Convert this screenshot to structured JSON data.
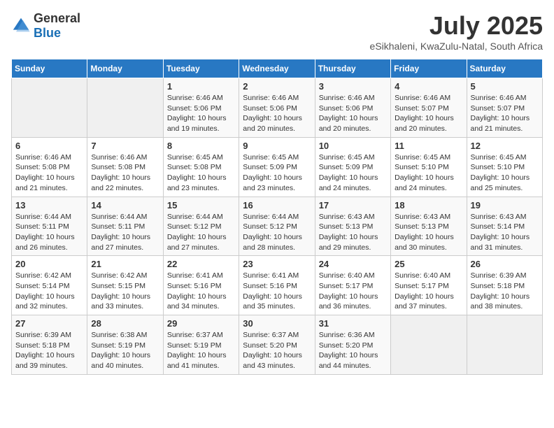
{
  "logo": {
    "general": "General",
    "blue": "Blue"
  },
  "title": "July 2025",
  "subtitle": "eSikhaleni, KwaZulu-Natal, South Africa",
  "weekdays": [
    "Sunday",
    "Monday",
    "Tuesday",
    "Wednesday",
    "Thursday",
    "Friday",
    "Saturday"
  ],
  "weeks": [
    [
      {
        "day": "",
        "sunrise": "",
        "sunset": "",
        "daylight": ""
      },
      {
        "day": "",
        "sunrise": "",
        "sunset": "",
        "daylight": ""
      },
      {
        "day": "1",
        "sunrise": "Sunrise: 6:46 AM",
        "sunset": "Sunset: 5:06 PM",
        "daylight": "Daylight: 10 hours and 19 minutes."
      },
      {
        "day": "2",
        "sunrise": "Sunrise: 6:46 AM",
        "sunset": "Sunset: 5:06 PM",
        "daylight": "Daylight: 10 hours and 20 minutes."
      },
      {
        "day": "3",
        "sunrise": "Sunrise: 6:46 AM",
        "sunset": "Sunset: 5:06 PM",
        "daylight": "Daylight: 10 hours and 20 minutes."
      },
      {
        "day": "4",
        "sunrise": "Sunrise: 6:46 AM",
        "sunset": "Sunset: 5:07 PM",
        "daylight": "Daylight: 10 hours and 20 minutes."
      },
      {
        "day": "5",
        "sunrise": "Sunrise: 6:46 AM",
        "sunset": "Sunset: 5:07 PM",
        "daylight": "Daylight: 10 hours and 21 minutes."
      }
    ],
    [
      {
        "day": "6",
        "sunrise": "Sunrise: 6:46 AM",
        "sunset": "Sunset: 5:08 PM",
        "daylight": "Daylight: 10 hours and 21 minutes."
      },
      {
        "day": "7",
        "sunrise": "Sunrise: 6:46 AM",
        "sunset": "Sunset: 5:08 PM",
        "daylight": "Daylight: 10 hours and 22 minutes."
      },
      {
        "day": "8",
        "sunrise": "Sunrise: 6:45 AM",
        "sunset": "Sunset: 5:08 PM",
        "daylight": "Daylight: 10 hours and 23 minutes."
      },
      {
        "day": "9",
        "sunrise": "Sunrise: 6:45 AM",
        "sunset": "Sunset: 5:09 PM",
        "daylight": "Daylight: 10 hours and 23 minutes."
      },
      {
        "day": "10",
        "sunrise": "Sunrise: 6:45 AM",
        "sunset": "Sunset: 5:09 PM",
        "daylight": "Daylight: 10 hours and 24 minutes."
      },
      {
        "day": "11",
        "sunrise": "Sunrise: 6:45 AM",
        "sunset": "Sunset: 5:10 PM",
        "daylight": "Daylight: 10 hours and 24 minutes."
      },
      {
        "day": "12",
        "sunrise": "Sunrise: 6:45 AM",
        "sunset": "Sunset: 5:10 PM",
        "daylight": "Daylight: 10 hours and 25 minutes."
      }
    ],
    [
      {
        "day": "13",
        "sunrise": "Sunrise: 6:44 AM",
        "sunset": "Sunset: 5:11 PM",
        "daylight": "Daylight: 10 hours and 26 minutes."
      },
      {
        "day": "14",
        "sunrise": "Sunrise: 6:44 AM",
        "sunset": "Sunset: 5:11 PM",
        "daylight": "Daylight: 10 hours and 27 minutes."
      },
      {
        "day": "15",
        "sunrise": "Sunrise: 6:44 AM",
        "sunset": "Sunset: 5:12 PM",
        "daylight": "Daylight: 10 hours and 27 minutes."
      },
      {
        "day": "16",
        "sunrise": "Sunrise: 6:44 AM",
        "sunset": "Sunset: 5:12 PM",
        "daylight": "Daylight: 10 hours and 28 minutes."
      },
      {
        "day": "17",
        "sunrise": "Sunrise: 6:43 AM",
        "sunset": "Sunset: 5:13 PM",
        "daylight": "Daylight: 10 hours and 29 minutes."
      },
      {
        "day": "18",
        "sunrise": "Sunrise: 6:43 AM",
        "sunset": "Sunset: 5:13 PM",
        "daylight": "Daylight: 10 hours and 30 minutes."
      },
      {
        "day": "19",
        "sunrise": "Sunrise: 6:43 AM",
        "sunset": "Sunset: 5:14 PM",
        "daylight": "Daylight: 10 hours and 31 minutes."
      }
    ],
    [
      {
        "day": "20",
        "sunrise": "Sunrise: 6:42 AM",
        "sunset": "Sunset: 5:14 PM",
        "daylight": "Daylight: 10 hours and 32 minutes."
      },
      {
        "day": "21",
        "sunrise": "Sunrise: 6:42 AM",
        "sunset": "Sunset: 5:15 PM",
        "daylight": "Daylight: 10 hours and 33 minutes."
      },
      {
        "day": "22",
        "sunrise": "Sunrise: 6:41 AM",
        "sunset": "Sunset: 5:16 PM",
        "daylight": "Daylight: 10 hours and 34 minutes."
      },
      {
        "day": "23",
        "sunrise": "Sunrise: 6:41 AM",
        "sunset": "Sunset: 5:16 PM",
        "daylight": "Daylight: 10 hours and 35 minutes."
      },
      {
        "day": "24",
        "sunrise": "Sunrise: 6:40 AM",
        "sunset": "Sunset: 5:17 PM",
        "daylight": "Daylight: 10 hours and 36 minutes."
      },
      {
        "day": "25",
        "sunrise": "Sunrise: 6:40 AM",
        "sunset": "Sunset: 5:17 PM",
        "daylight": "Daylight: 10 hours and 37 minutes."
      },
      {
        "day": "26",
        "sunrise": "Sunrise: 6:39 AM",
        "sunset": "Sunset: 5:18 PM",
        "daylight": "Daylight: 10 hours and 38 minutes."
      }
    ],
    [
      {
        "day": "27",
        "sunrise": "Sunrise: 6:39 AM",
        "sunset": "Sunset: 5:18 PM",
        "daylight": "Daylight: 10 hours and 39 minutes."
      },
      {
        "day": "28",
        "sunrise": "Sunrise: 6:38 AM",
        "sunset": "Sunset: 5:19 PM",
        "daylight": "Daylight: 10 hours and 40 minutes."
      },
      {
        "day": "29",
        "sunrise": "Sunrise: 6:37 AM",
        "sunset": "Sunset: 5:19 PM",
        "daylight": "Daylight: 10 hours and 41 minutes."
      },
      {
        "day": "30",
        "sunrise": "Sunrise: 6:37 AM",
        "sunset": "Sunset: 5:20 PM",
        "daylight": "Daylight: 10 hours and 43 minutes."
      },
      {
        "day": "31",
        "sunrise": "Sunrise: 6:36 AM",
        "sunset": "Sunset: 5:20 PM",
        "daylight": "Daylight: 10 hours and 44 minutes."
      },
      {
        "day": "",
        "sunrise": "",
        "sunset": "",
        "daylight": ""
      },
      {
        "day": "",
        "sunrise": "",
        "sunset": "",
        "daylight": ""
      }
    ]
  ]
}
